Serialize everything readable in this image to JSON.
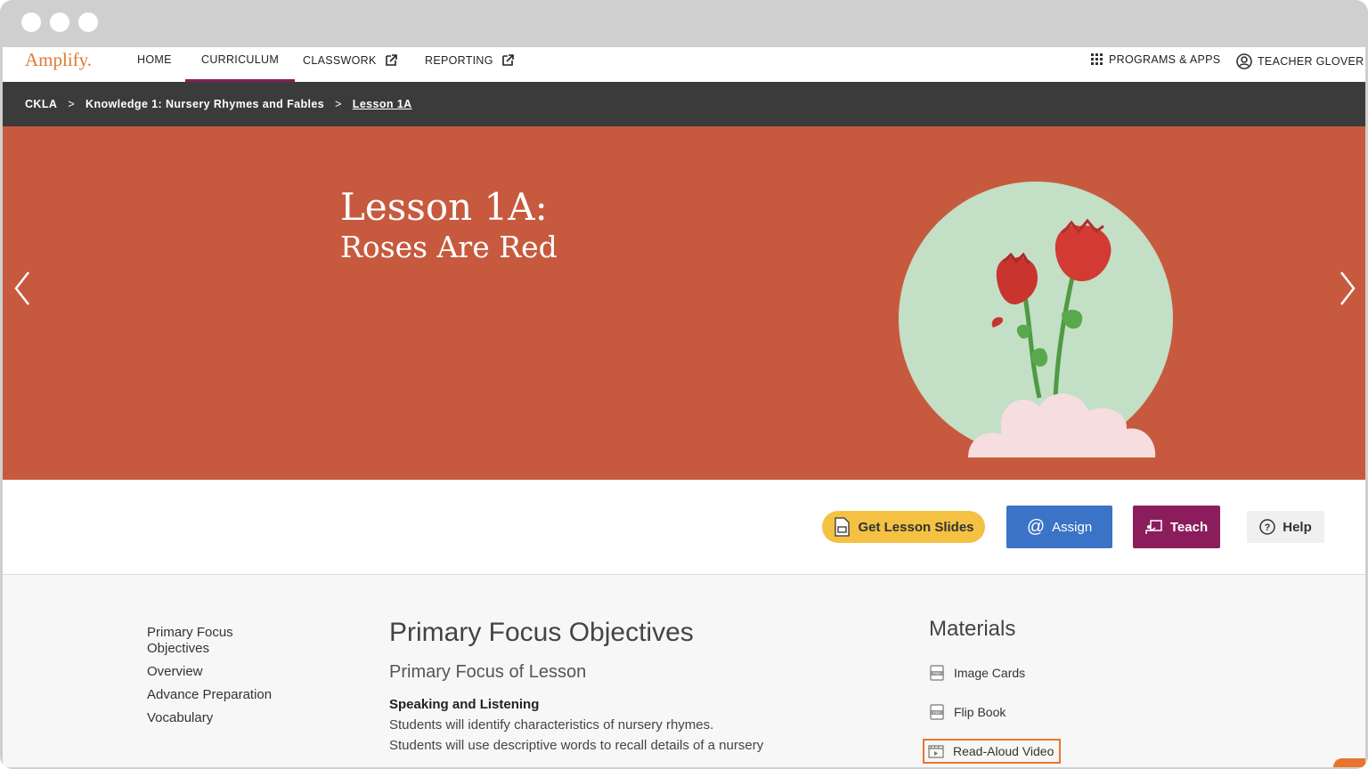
{
  "brand": {
    "logo_text": "Amplify.",
    "logo_color": "#e07a32",
    "accent": "#8b1d5c"
  },
  "nav": {
    "home": "HOME",
    "curriculum": "CURRICULUM",
    "classwork": "CLASSWORK",
    "reporting": "REPORTING",
    "programs": "PROGRAMS & APPS",
    "user": "TEACHER GLOVER"
  },
  "breadcrumb": {
    "items": [
      "CKLA",
      "Knowledge 1: Nursery Rhymes and Fables",
      "Lesson 1A"
    ],
    "separator": ">"
  },
  "hero": {
    "title": "Lesson 1A:",
    "subtitle": "Roses Are Red",
    "background": "#c75a3e"
  },
  "actions": {
    "slides_label": "Get Lesson Slides",
    "assign_label": "Assign",
    "teach_label": "Teach",
    "help_label": "Help"
  },
  "sidenav": {
    "items": [
      "Primary Focus Objectives",
      "Overview",
      "Advance Preparation",
      "Vocabulary"
    ]
  },
  "objectives": {
    "title": "Primary Focus Objectives",
    "subtitle": "Primary Focus of Lesson",
    "section_heading": "Speaking and Listening",
    "lines": [
      "Students will identify characteristics of nursery rhymes.",
      "Students will use descriptive words to recall details of a nursery"
    ]
  },
  "materials": {
    "title": "Materials",
    "items": [
      {
        "label": "Image Cards",
        "icon": "pdf-icon"
      },
      {
        "label": "Flip Book",
        "icon": "pdf-icon"
      },
      {
        "label": "Read-Aloud Video",
        "icon": "video-icon"
      }
    ]
  }
}
